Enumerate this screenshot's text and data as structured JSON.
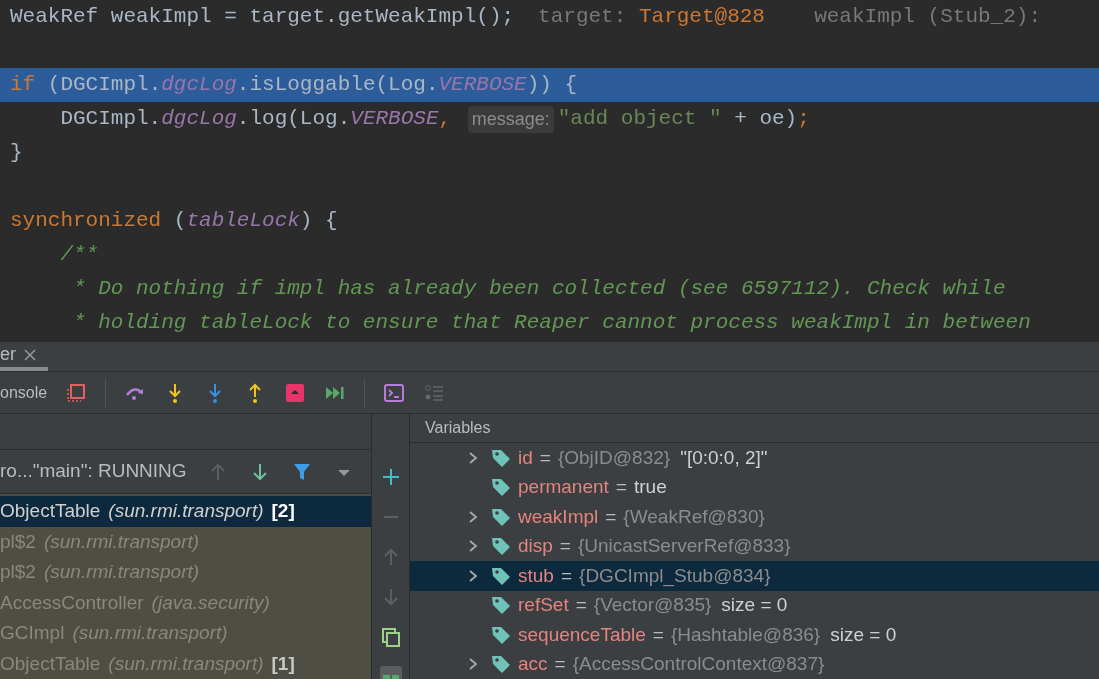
{
  "code": {
    "blocks": [
      [
        {
          "selected": false,
          "tokens": [
            {
              "kind": "plain",
              "text": "WeakRef weakImpl = target.getWeakImpl();"
            },
            {
              "kind": "value_hint",
              "text": "target: "
            },
            {
              "kind": "value_hint_accent",
              "text": "Target@828"
            },
            {
              "kind": "value_hint",
              "text": "  weakImpl (Stub_2):"
            }
          ]
        }
      ],
      [
        {
          "selected": true,
          "tokens": [
            {
              "kind": "keyword",
              "text": "if "
            },
            {
              "kind": "plain",
              "text": "(DGCImpl."
            },
            {
              "kind": "field",
              "text": "dgcLog"
            },
            {
              "kind": "plain",
              "text": ".isLoggable(Log."
            },
            {
              "kind": "field",
              "text": "VERBOSE"
            },
            {
              "kind": "plain",
              "text": ")) {"
            }
          ]
        },
        {
          "selected": false,
          "tokens": [
            {
              "kind": "plain",
              "text": "    DGCImpl."
            },
            {
              "kind": "field",
              "text": "dgcLog"
            },
            {
              "kind": "plain",
              "text": ".log(Log."
            },
            {
              "kind": "field",
              "text": "VERBOSE"
            },
            {
              "kind": "keyword",
              "text": ", "
            },
            {
              "kind": "param_hint",
              "text": "message:"
            },
            {
              "kind": "string",
              "text": "\"add object \""
            },
            {
              "kind": "plain",
              "text": " + oe)"
            },
            {
              "kind": "keyword",
              "text": ";"
            }
          ]
        },
        {
          "selected": false,
          "tokens": [
            {
              "kind": "plain",
              "text": "}"
            }
          ]
        }
      ],
      [
        {
          "selected": false,
          "tokens": [
            {
              "kind": "keyword",
              "text": "synchronized "
            },
            {
              "kind": "plain",
              "text": "("
            },
            {
              "kind": "field",
              "text": "tableLock"
            },
            {
              "kind": "plain",
              "text": ") {"
            }
          ]
        },
        {
          "selected": false,
          "tokens": [
            {
              "kind": "comment",
              "text": "    /**"
            }
          ]
        },
        {
          "selected": false,
          "tokens": [
            {
              "kind": "comment",
              "text": "     * Do nothing if impl has already been collected (see 6597112). Check while"
            }
          ]
        },
        {
          "selected": false,
          "tokens": [
            {
              "kind": "comment",
              "text": "     * holding tableLock to ensure that Reaper cannot process weakImpl in between"
            }
          ]
        }
      ]
    ]
  },
  "debugger": {
    "tab": {
      "label": "er",
      "selected": true
    },
    "toolbar": {
      "console_label": "onsole"
    },
    "frames": {
      "thread": "ro...\"main\": RUNNING",
      "items": [
        {
          "method": "ObjectTable",
          "package": "(sun.rmi.transport)",
          "badge": "[2]",
          "selected": true,
          "library": false
        },
        {
          "method": "pl$2",
          "package": "(sun.rmi.transport)",
          "selected": false,
          "library": true
        },
        {
          "method": "pl$2",
          "package": "(sun.rmi.transport)",
          "selected": false,
          "library": true
        },
        {
          "method": "AccessController",
          "package": "(java.security)",
          "selected": false,
          "library": true
        },
        {
          "method": "GCImpl",
          "package": "(sun.rmi.transport)",
          "selected": false,
          "library": true
        },
        {
          "method": "ObjectTable",
          "package": "(sun.rmi.transport)",
          "badge": "[1]",
          "selected": false,
          "library": true
        }
      ]
    },
    "variables": {
      "title": "Variables",
      "items": [
        {
          "name": "id",
          "separator": "=",
          "value": "{ObjID@832}",
          "extra": "\"[0:0:0, 2]\"",
          "expandable": true,
          "selected": false
        },
        {
          "name": "permanent",
          "separator": "=",
          "extra": "true",
          "expandable": false,
          "selected": false
        },
        {
          "name": "weakImpl",
          "separator": "=",
          "value": "{WeakRef@830}",
          "expandable": true,
          "selected": false
        },
        {
          "name": "disp",
          "separator": "=",
          "value": "{UnicastServerRef@833}",
          "expandable": true,
          "selected": false
        },
        {
          "name": "stub",
          "separator": "=",
          "value": "{DGCImpl_Stub@834}",
          "expandable": true,
          "selected": true
        },
        {
          "name": "refSet",
          "separator": "=",
          "value": "{Vector@835}",
          "extra": "size = 0",
          "expandable": false,
          "selected": false
        },
        {
          "name": "sequenceTable",
          "separator": "=",
          "value": "{Hashtable@836}",
          "extra": "size = 0",
          "expandable": false,
          "selected": false
        },
        {
          "name": "acc",
          "separator": "=",
          "value": "{AccessControlContext@837}",
          "expandable": true,
          "selected": false
        }
      ]
    }
  }
}
